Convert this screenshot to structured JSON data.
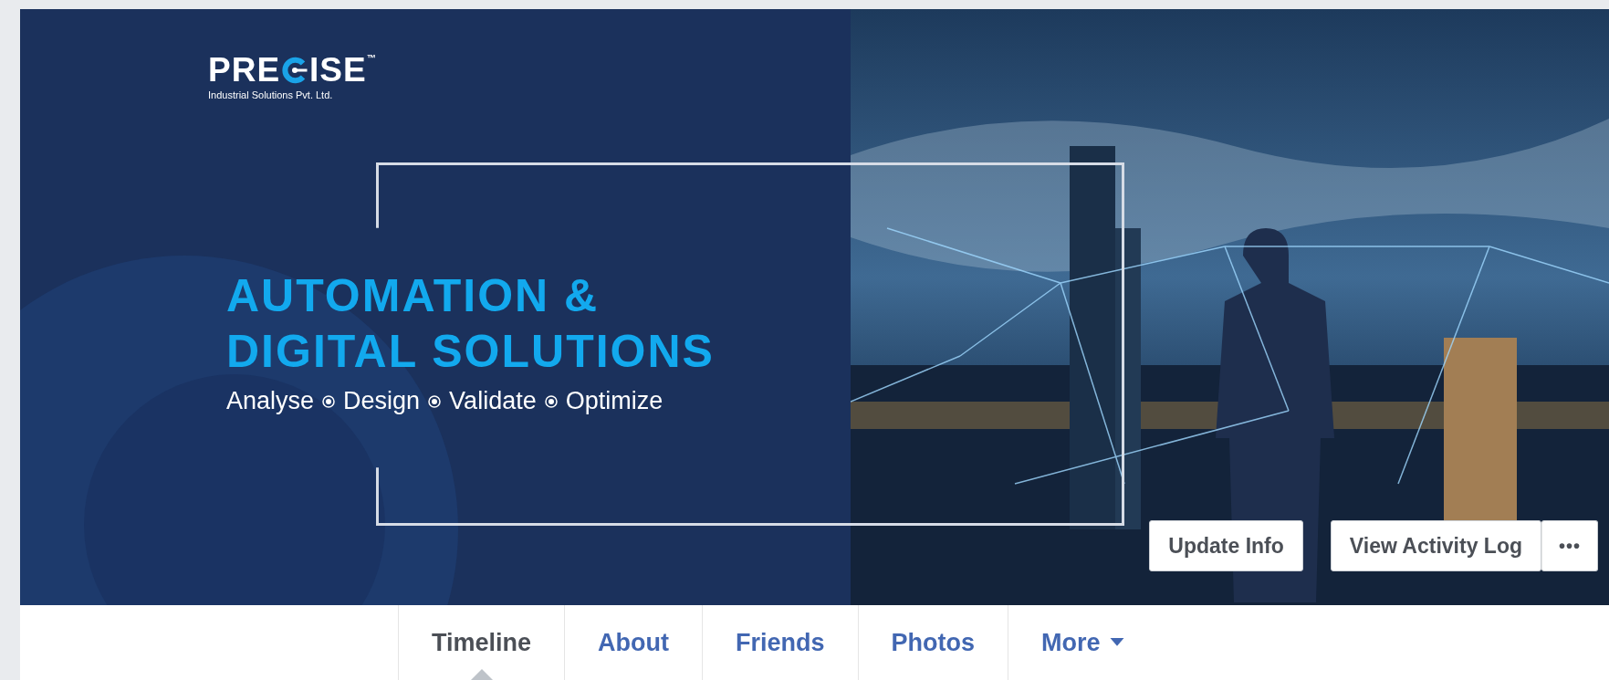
{
  "cover": {
    "logo": {
      "before": "PRE",
      "after": "ISE",
      "mark": "™",
      "tagline": "Industrial Solutions Pvt. Ltd."
    },
    "headline": [
      "AUTOMATION &",
      "DIGITAL SOLUTIONS"
    ],
    "steps": [
      "Analyse",
      "Design",
      "Validate",
      "Optimize"
    ],
    "photo": {
      "kind": "picture"
    },
    "buttons": [
      {
        "label": "Update Info",
        "kind": "text"
      },
      {
        "label": "View Activity Log",
        "kind": "text"
      },
      {
        "label": "•••",
        "kind": "more"
      }
    ]
  },
  "tabs": [
    {
      "label": "Timeline",
      "selected": true,
      "dropdown": false
    },
    {
      "label": "About",
      "selected": false,
      "dropdown": false
    },
    {
      "label": "Friends",
      "selected": false,
      "dropdown": false
    },
    {
      "label": "Photos",
      "selected": false,
      "dropdown": false
    },
    {
      "label": "More",
      "selected": false,
      "dropdown": true
    }
  ]
}
